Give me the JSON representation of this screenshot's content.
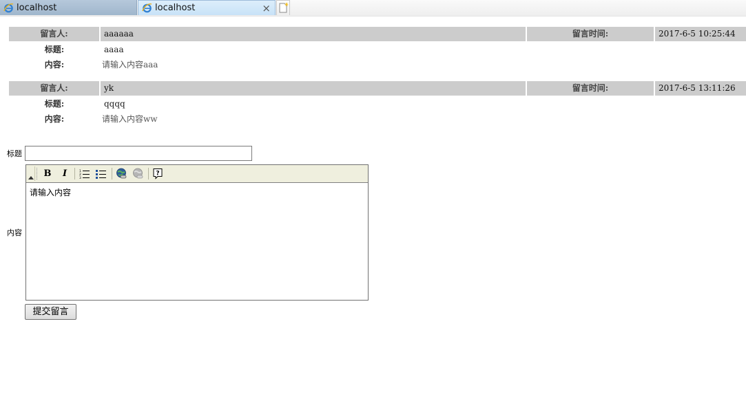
{
  "browser": {
    "tabs": [
      {
        "label": "localhost",
        "active": false
      },
      {
        "label": "localhost",
        "active": true
      }
    ],
    "close_glyph": "×",
    "icons": {
      "tab": "ie-icon",
      "new_tab": "new-tab-icon"
    }
  },
  "messages": [
    {
      "author_label": "留言人:",
      "author": "aaaaaa",
      "time_label": "留言时间:",
      "time": "2017-6-5 10:25:44",
      "title_label": "标题:",
      "title": "aaaa",
      "content_label": "内容:",
      "content": "请输入内容aaa"
    },
    {
      "author_label": "留言人:",
      "author": "yk",
      "time_label": "留言时间:",
      "time": "2017-6-5 13:11:26",
      "title_label": "标题:",
      "title": "qqqq",
      "content_label": "内容:",
      "content": "请输入内容ww"
    }
  ],
  "form": {
    "title_label": "标题",
    "title_value": "",
    "content_label": "内容",
    "editor_text": "请输入内容",
    "toolbar": {
      "bold": "B",
      "italic": "I",
      "icons": [
        "bold-icon",
        "italic-icon",
        "ordered-list-icon",
        "unordered-list-icon",
        "link-icon",
        "unlink-icon",
        "help-icon"
      ]
    },
    "submit_label": "提交留言"
  },
  "colors": {
    "header_row_bg": "#cccccc",
    "toolbar_bg": "#efefde",
    "active_tab": "#cfe5f8",
    "inactive_tab": "#a9bfd4"
  }
}
